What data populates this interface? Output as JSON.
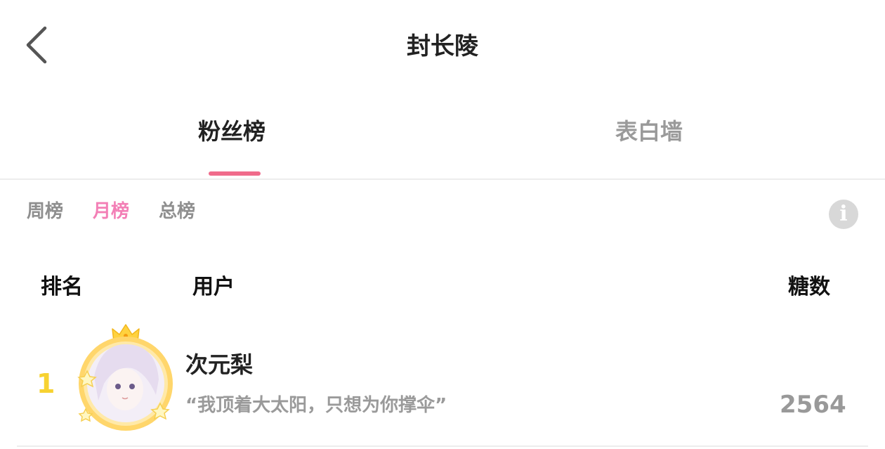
{
  "header": {
    "title": "封长陵",
    "back_icon": "chevron-left-icon"
  },
  "tabs": [
    {
      "label": "粉丝榜",
      "active": true
    },
    {
      "label": "表白墙",
      "active": false
    }
  ],
  "periods": [
    {
      "label": "周榜",
      "active": false
    },
    {
      "label": "月榜",
      "active": true
    },
    {
      "label": "总榜",
      "active": false
    }
  ],
  "info_icon": {
    "glyph": "i",
    "name": "info-icon"
  },
  "table_header": {
    "rank": "排名",
    "user": "用户",
    "sugar": "糖数"
  },
  "rows": [
    {
      "rank": "1",
      "name": "次元梨",
      "quote": "“我顶着大太阳，只想为你撑伞”",
      "sugar": "2564"
    }
  ],
  "colors": {
    "accent_pink": "#f06b8b",
    "active_period": "#f37fb6",
    "rank_gold": "#f7d231",
    "muted_text": "#9a9a9a"
  }
}
